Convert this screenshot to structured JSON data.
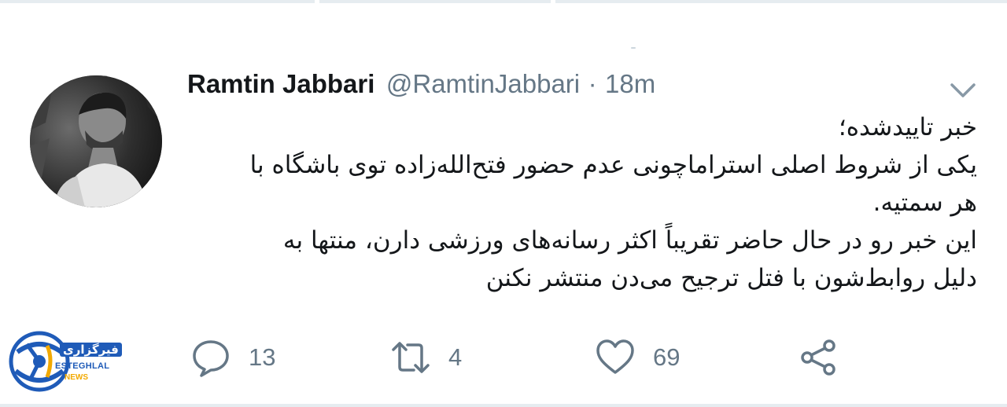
{
  "tweet": {
    "author_name": "Ramtin Jabbari",
    "handle": "@RamtinJabbari",
    "separator": "·",
    "time": "18m",
    "text_lines": [
      "خبر تاییدشده؛",
      "یکی از شروط اصلی استراماچونی عدم حضور فتح‌الله‌زاده توی باشگاه با",
      "هر سمتیه.",
      "این خبر رو در حال حاضر تقریباً اکثر رسانه‌های ورزشی دارن، منتها به",
      "دلیل روابط‌شون با فتل ترجیح می‌دن منتشر نکنن"
    ]
  },
  "actions": {
    "reply": {
      "icon": "reply-icon",
      "count": "13"
    },
    "retweet": {
      "icon": "retweet-icon",
      "count": "4"
    },
    "like": {
      "icon": "heart-icon",
      "count": "69"
    },
    "share": {
      "icon": "share-icon"
    }
  },
  "watermark": {
    "title": "فیرگزاری",
    "brand": "ESTEGHLAL",
    "sub": "NEWS"
  },
  "colors": {
    "text": "#14171a",
    "muted": "#657786",
    "border": "#e6ecf0",
    "brand_blue": "#1f5bb8",
    "brand_yellow": "#f2a900"
  }
}
